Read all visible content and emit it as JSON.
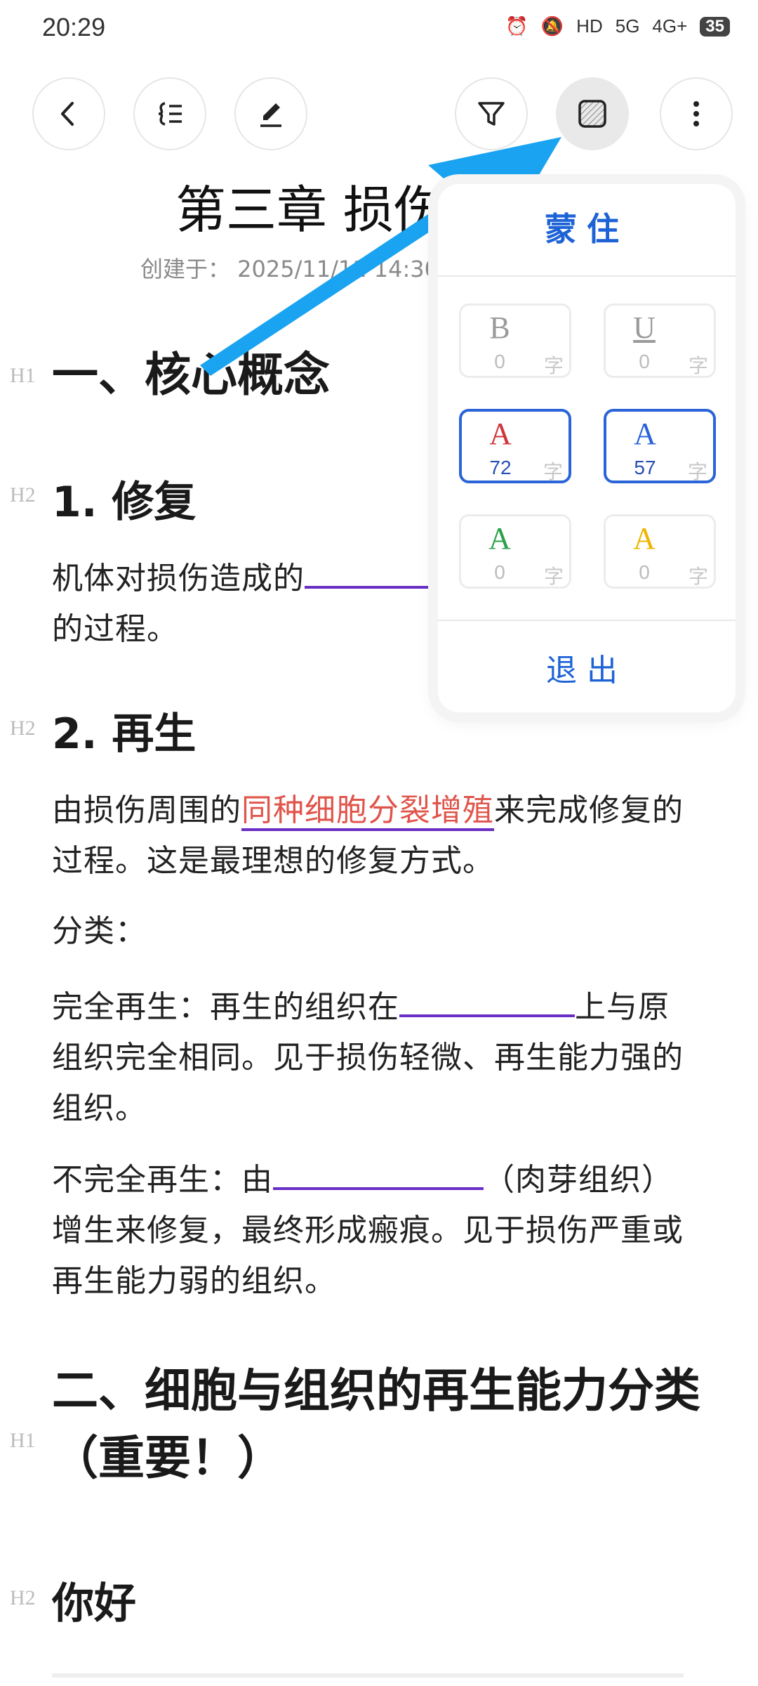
{
  "status_bar": {
    "time": "20:29",
    "indicators": [
      "⏰",
      "🔕",
      "HD",
      "5G",
      "4G+"
    ],
    "battery": "35"
  },
  "toolbar": {
    "back_icon": "chevron-left-icon",
    "outline_icon": "outline-list-icon",
    "edit_icon": "pencil-icon",
    "filter_icon": "funnel-icon",
    "mask_icon": "hatched-square-icon",
    "more_icon": "vertical-dots-icon"
  },
  "document": {
    "title": "第三章 损伤修复",
    "created": "创建于： 2025/11/11 14:30",
    "sections": {
      "h1_1": "一、核心概念",
      "h2_1": "1. 修复",
      "p1_a": "机体对损伤造成的",
      "p1_b": "的过程。",
      "h2_2": "2. 再生",
      "p2_a": "由损伤周围的",
      "p2_red": "同种细胞分裂增殖",
      "p2_b": "来完成修复的过程。这是最理想的修复方式。",
      "p3": "分类：",
      "p4_a": "完全再生：再生的组织在",
      "p4_b": "上与原组织完全相同。见于损伤轻微、再生能力强的组织。",
      "p5_a": "不完全再生：由",
      "p5_b": "（肉芽组织）增生来修复，最终形成瘢痕。见于损伤严重或再生能力弱的组织。",
      "h1_2": "二、细胞与组织的再生能力分类（重要！）",
      "h2_3": "你好"
    },
    "heading_marks": {
      "h1": "H1",
      "h2": "H2"
    }
  },
  "mask_panel": {
    "title": "蒙住",
    "exit": "退出",
    "unit": "字",
    "cells": [
      {
        "symbol": "B",
        "count": "0",
        "color": "#9a9a9a",
        "count_color": "#bbbbbb",
        "selected": false
      },
      {
        "symbol": "U",
        "count": "0",
        "color": "#9a9a9a",
        "count_color": "#bbbbbb",
        "selected": false
      },
      {
        "symbol": "A",
        "count": "72",
        "color": "#d0353a",
        "count_color": "#2a4fb5",
        "selected": true
      },
      {
        "symbol": "A",
        "count": "57",
        "color": "#2a64d8",
        "count_color": "#2a4fb5",
        "selected": true
      },
      {
        "symbol": "A",
        "count": "0",
        "color": "#2aa04a",
        "count_color": "#bbbbbb",
        "selected": false
      },
      {
        "symbol": "A",
        "count": "0",
        "color": "#f0b400",
        "count_color": "#bbbbbb",
        "selected": false
      }
    ]
  },
  "colors": {
    "accent": "#1e63d6",
    "blank_underline": "#6a2fc4",
    "annotation_arrow": "#1aa3f0"
  }
}
